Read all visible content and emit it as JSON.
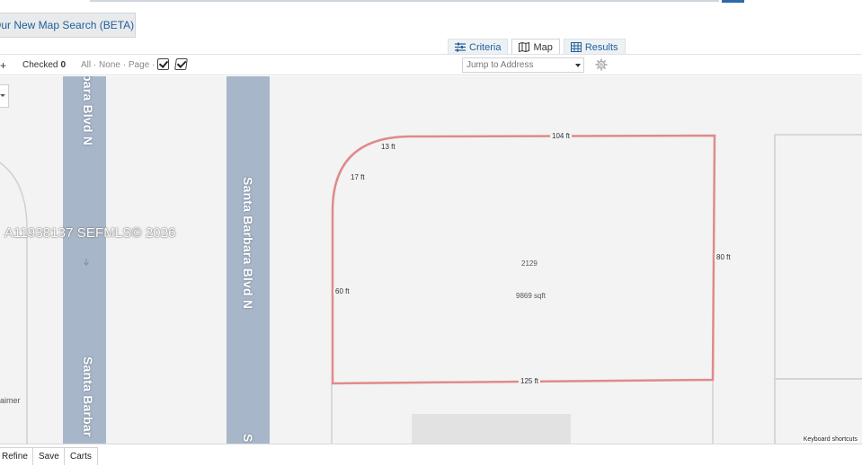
{
  "banner": {
    "label": "Our New Map Search (BETA)"
  },
  "view_tabs": [
    {
      "label": "Criteria",
      "icon": "sliders-icon"
    },
    {
      "label": "Map",
      "icon": "map-icon",
      "active": true
    },
    {
      "label": "Results",
      "icon": "grid-icon"
    }
  ],
  "toolbar": {
    "plus": "+",
    "checked_label": "Checked",
    "checked_count": "0",
    "select_all": "All",
    "select_none": "None",
    "select_page": "Page",
    "sep": "·",
    "jump_placeholder": "Jump to Address"
  },
  "map": {
    "roads": [
      {
        "label": "Santa Barbara Blvd N"
      },
      {
        "label": "Santa Barbara Blvd N"
      }
    ],
    "road1_top_label": "bara Blvd N",
    "road1_bottom_label": "Santa Barbar",
    "road2_bottom_label": "S",
    "watermark": "A11938137  SEFMLS© 2026",
    "disclaimer": "laimer",
    "keyboard_shortcuts": "Keyboard shortcuts",
    "parcel": {
      "dim_top": "104 ft",
      "dim_curve_top": "13 ft",
      "dim_curve_left": "17 ft",
      "dim_left": "60 ft",
      "dim_right": "80 ft",
      "dim_bottom": "125 ft",
      "lot_number": "2129",
      "area": "9869 sqft",
      "line_color": "#e08a8a"
    }
  },
  "bottom_buttons": [
    "Refine",
    "Save",
    "Carts"
  ],
  "colors": {
    "road": "#a8b6c9",
    "map_bg": "#f3f3f3",
    "link": "#1f5f99"
  }
}
